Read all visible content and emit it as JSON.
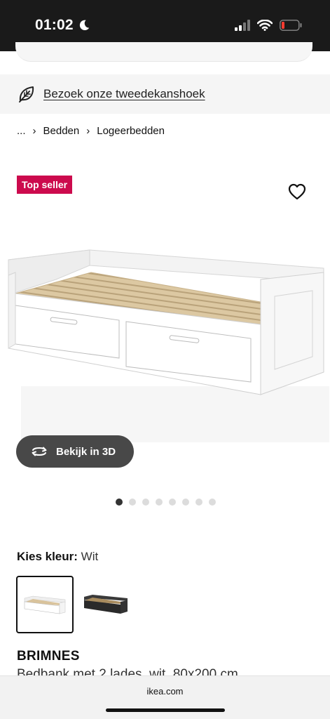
{
  "status_bar": {
    "time": "01:02"
  },
  "banner": {
    "link_text": "Bezoek onze tweedekanshoek"
  },
  "breadcrumb": {
    "ellipsis": "...",
    "sep": "›",
    "items": [
      "Bedden",
      "Logeerbedden"
    ]
  },
  "product": {
    "badge": "Top seller",
    "view3d_label": "Bekijk in 3D",
    "gallery_count": 8,
    "gallery_active_index": 0,
    "color_label": "Kies kleur:",
    "color_value": "Wit",
    "swatches": [
      "white-bed-swatch",
      "black-bed-swatch"
    ],
    "name": "BRIMNES",
    "description": "Bedbank met 2 lades, wit, 80x200 cm"
  },
  "browser": {
    "url": "ikea.com"
  },
  "colors": {
    "badge_red": "#cc0a4d",
    "button_grey": "#484848",
    "status_bar": "#1a1a1a"
  }
}
